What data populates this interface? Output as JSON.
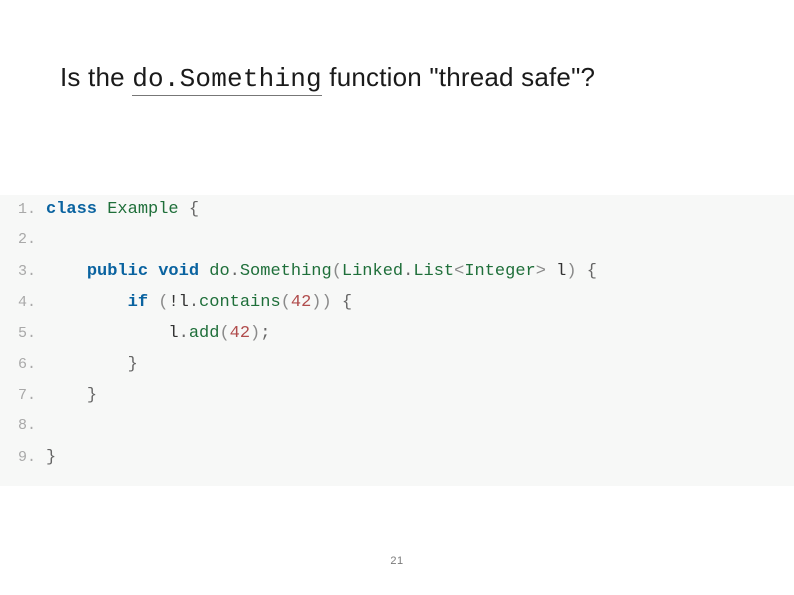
{
  "title": {
    "pre": "Is the ",
    "code": "do.Something",
    "post": " function \"thread safe\"?"
  },
  "code": {
    "lines": [
      {
        "n": "1.",
        "kw1": "class",
        "sp1": " ",
        "typ1": "Example",
        "sp2": " ",
        "brace": "{"
      },
      {
        "n": "2."
      },
      {
        "n": "3.",
        "indent": "    ",
        "kw1": "public",
        "sp1": " ",
        "kw2": "void",
        "sp2": " ",
        "m1": "do",
        "dot1": ".",
        "m2": "Something",
        "args": "(",
        "t1": "Linked",
        "dot2": ".",
        "t2": "List",
        "lt": "<",
        "t3": "Integer",
        "gt": ">",
        "sp3": " ",
        "var": "l",
        "argsend": ")",
        "sp4": " ",
        "brace": "{"
      },
      {
        "n": "4.",
        "indent": "        ",
        "kw1": "if",
        "sp1": " ",
        "args": "(",
        "neg": "!",
        "obj": "l",
        "dot1": ".",
        "m1": "contains",
        "args2": "(",
        "num": "42",
        "args2end": ")",
        "argsend": ")",
        "sp2": " ",
        "brace": "{"
      },
      {
        "n": "5.",
        "indent": "            ",
        "obj": "l",
        "dot1": ".",
        "m1": "add",
        "args": "(",
        "num": "42",
        "argsend": ")",
        "semi": ";"
      },
      {
        "n": "6.",
        "indent": "        ",
        "brace": "}"
      },
      {
        "n": "7.",
        "indent": "    ",
        "brace": "}"
      },
      {
        "n": "8."
      },
      {
        "n": "9.",
        "brace": "}"
      }
    ]
  },
  "page_number": "21"
}
